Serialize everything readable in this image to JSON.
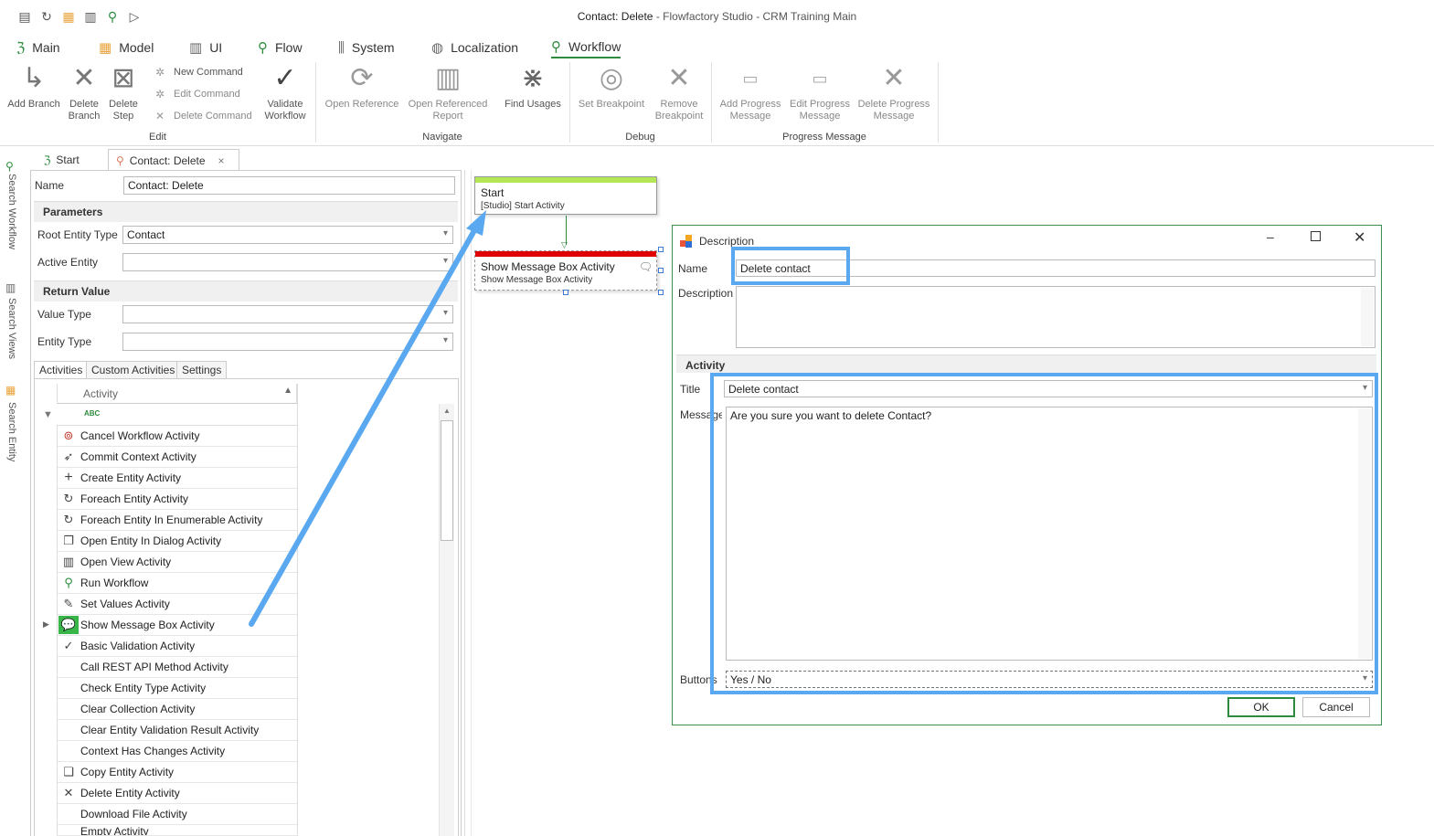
{
  "window": {
    "title_doc": "Contact: Delete",
    "title_app": " - Flowfactory Studio - CRM Training Main"
  },
  "menu": [
    "Main",
    "Model",
    "UI",
    "Flow",
    "System",
    "Localization",
    "Workflow"
  ],
  "ribbon": {
    "add_branch": "Add Branch",
    "delete_branch": "Delete Branch",
    "delete_step": "Delete Step",
    "new_command": "New Command",
    "edit_command": "Edit Command",
    "delete_command": "Delete Command",
    "validate_workflow": "Validate Workflow",
    "open_reference": "Open Reference",
    "open_referenced_report": "Open Referenced Report",
    "find_usages": "Find Usages",
    "set_breakpoint": "Set Breakpoint",
    "remove_breakpoint": "Remove Breakpoint",
    "add_progress": "Add Progress Message",
    "edit_progress": "Edit Progress Message",
    "delete_progress": "Delete Progress Message",
    "groups": {
      "edit": "Edit",
      "navigate": "Navigate",
      "debug": "Debug",
      "progress": "Progress Message"
    }
  },
  "side": {
    "search_workflow": "Search Workflow",
    "search_views": "Search Views",
    "search_entity": "Search Entity"
  },
  "doctabs": {
    "start": "Start",
    "current": "Contact: Delete"
  },
  "props": {
    "name_label": "Name",
    "name_value": "Contact: Delete",
    "parameters": "Parameters",
    "root_entity_label": "Root Entity Type",
    "root_entity_value": "Contact",
    "active_entity_label": "Active Entity",
    "return_value": "Return Value",
    "value_type_label": "Value Type",
    "entity_type_label": "Entity Type"
  },
  "activity_tabs": [
    "Activities",
    "Custom Activities",
    "Settings"
  ],
  "activity_list": {
    "header": "Activity",
    "filter_glyph": "ABC",
    "items": [
      "Cancel Workflow Activity",
      "Commit Context Activity",
      "Create Entity Activity",
      "Foreach Entity Activity",
      "Foreach Entity In Enumerable Activity",
      "Open Entity In Dialog Activity",
      "Open View Activity",
      "Run Workflow",
      "Set Values Activity",
      "Show Message Box  Activity",
      "Basic Validation Activity",
      "Call REST API Method Activity",
      "Check Entity Type Activity",
      "Clear Collection Activity",
      "Clear Entity Validation Result Activity",
      "Context Has Changes Activity",
      "Copy Entity Activity",
      "Delete Entity Activity",
      "Download File Activity",
      "Empty Activity"
    ]
  },
  "canvas": {
    "start": {
      "title": "Start",
      "sub": "[Studio] Start Activity"
    },
    "msgbox": {
      "title": "Show Message Box Activity",
      "sub": "Show Message Box  Activity"
    }
  },
  "dialog": {
    "title": "Description",
    "name_label": "Name",
    "name_value": "Delete contact",
    "description_label": "Description",
    "activity_section": "Activity",
    "title_label": "Title",
    "title_value": "Delete contact",
    "message_label": "Message",
    "message_value": "Are you sure you want to delete Contact?",
    "buttons_label": "Buttons",
    "buttons_value": "Yes / No",
    "ok": "OK",
    "cancel": "Cancel"
  },
  "colors": {
    "accent_green": "#2e8b3e",
    "highlight_blue": "#5aa9f0",
    "start_bar": "#b5e655",
    "error_bar": "#e00000"
  }
}
